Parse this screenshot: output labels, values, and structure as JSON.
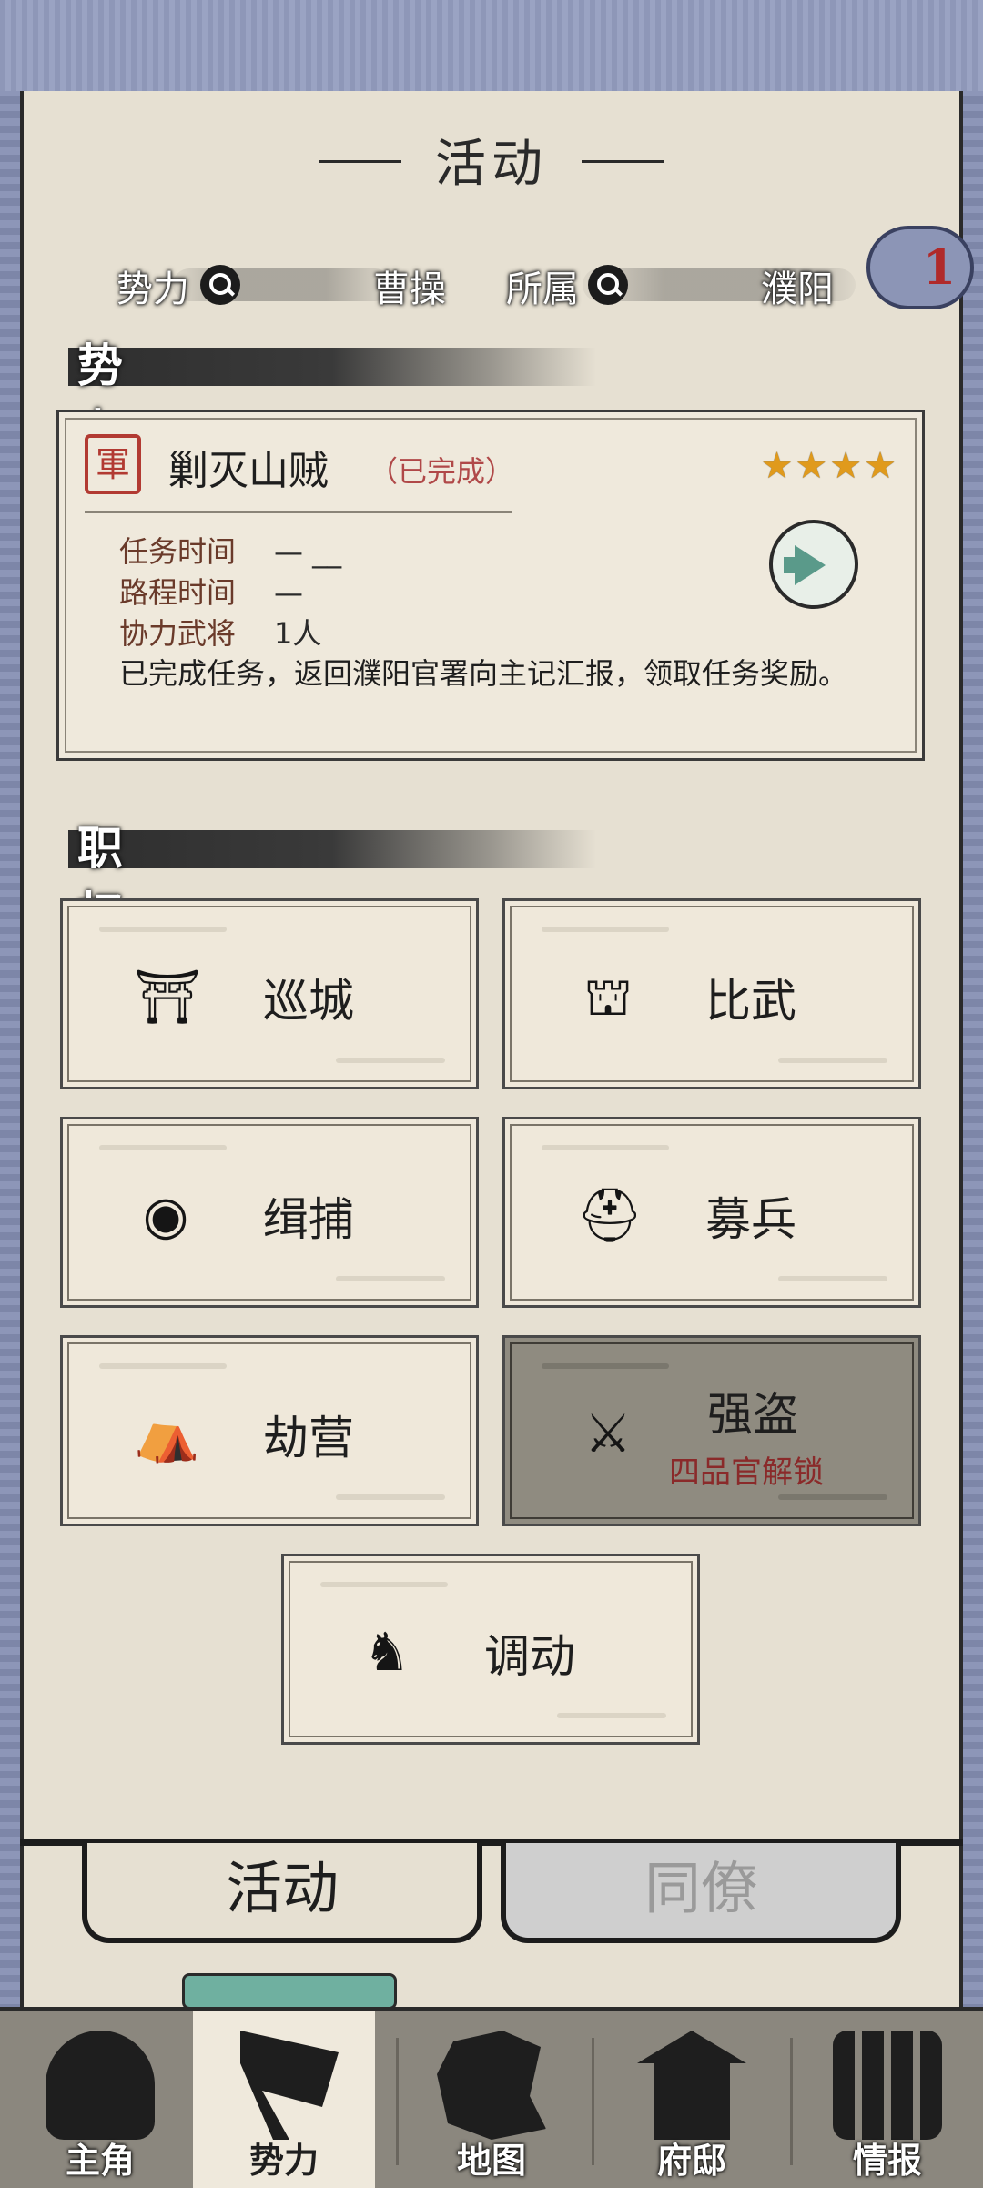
{
  "page": {
    "title": "活动"
  },
  "info_bar": {
    "faction_label": "势力",
    "faction_value": "曹操",
    "belong_label": "所属",
    "belong_value": "濮阳",
    "badge_count": "1"
  },
  "task_section": {
    "header": "势力任务",
    "card": {
      "seal_char": "軍",
      "title": "剿灭山贼",
      "status": "（已完成）",
      "stars": "★★★★",
      "rows": [
        {
          "key": "任务时间",
          "value": "—  __"
        },
        {
          "key": "路程时间",
          "value": "—"
        },
        {
          "key": "协力武将",
          "value": "1人"
        }
      ],
      "description": "已完成任务，返回濮阳官署向主记汇报，领取任务奖励。"
    }
  },
  "duty_section": {
    "header": "职权",
    "buttons": [
      {
        "label": "巡城",
        "icon": "city-gate-icon"
      },
      {
        "label": "比武",
        "icon": "arena-gate-icon"
      },
      {
        "label": "缉捕",
        "icon": "arrest-seal-icon"
      },
      {
        "label": "募兵",
        "icon": "soldier-helmet-icon"
      },
      {
        "label": "劫营",
        "icon": "camp-tents-icon"
      },
      {
        "label": "强盗",
        "icon": "crossed-swords-icon",
        "locked": true,
        "lock_text": "四品官解锁"
      },
      {
        "label": "调动",
        "icon": "chariot-icon"
      }
    ]
  },
  "tabs": [
    {
      "label": "活动",
      "active": true
    },
    {
      "label": "同僚",
      "active": false
    }
  ],
  "bottom_nav": [
    {
      "label": "主角",
      "icon": "warrior-icon"
    },
    {
      "label": "势力",
      "icon": "flag-icon",
      "active": true
    },
    {
      "label": "地图",
      "icon": "map-icon"
    },
    {
      "label": "府邸",
      "icon": "mansion-icon"
    },
    {
      "label": "情报",
      "icon": "scrolls-icon"
    }
  ]
}
